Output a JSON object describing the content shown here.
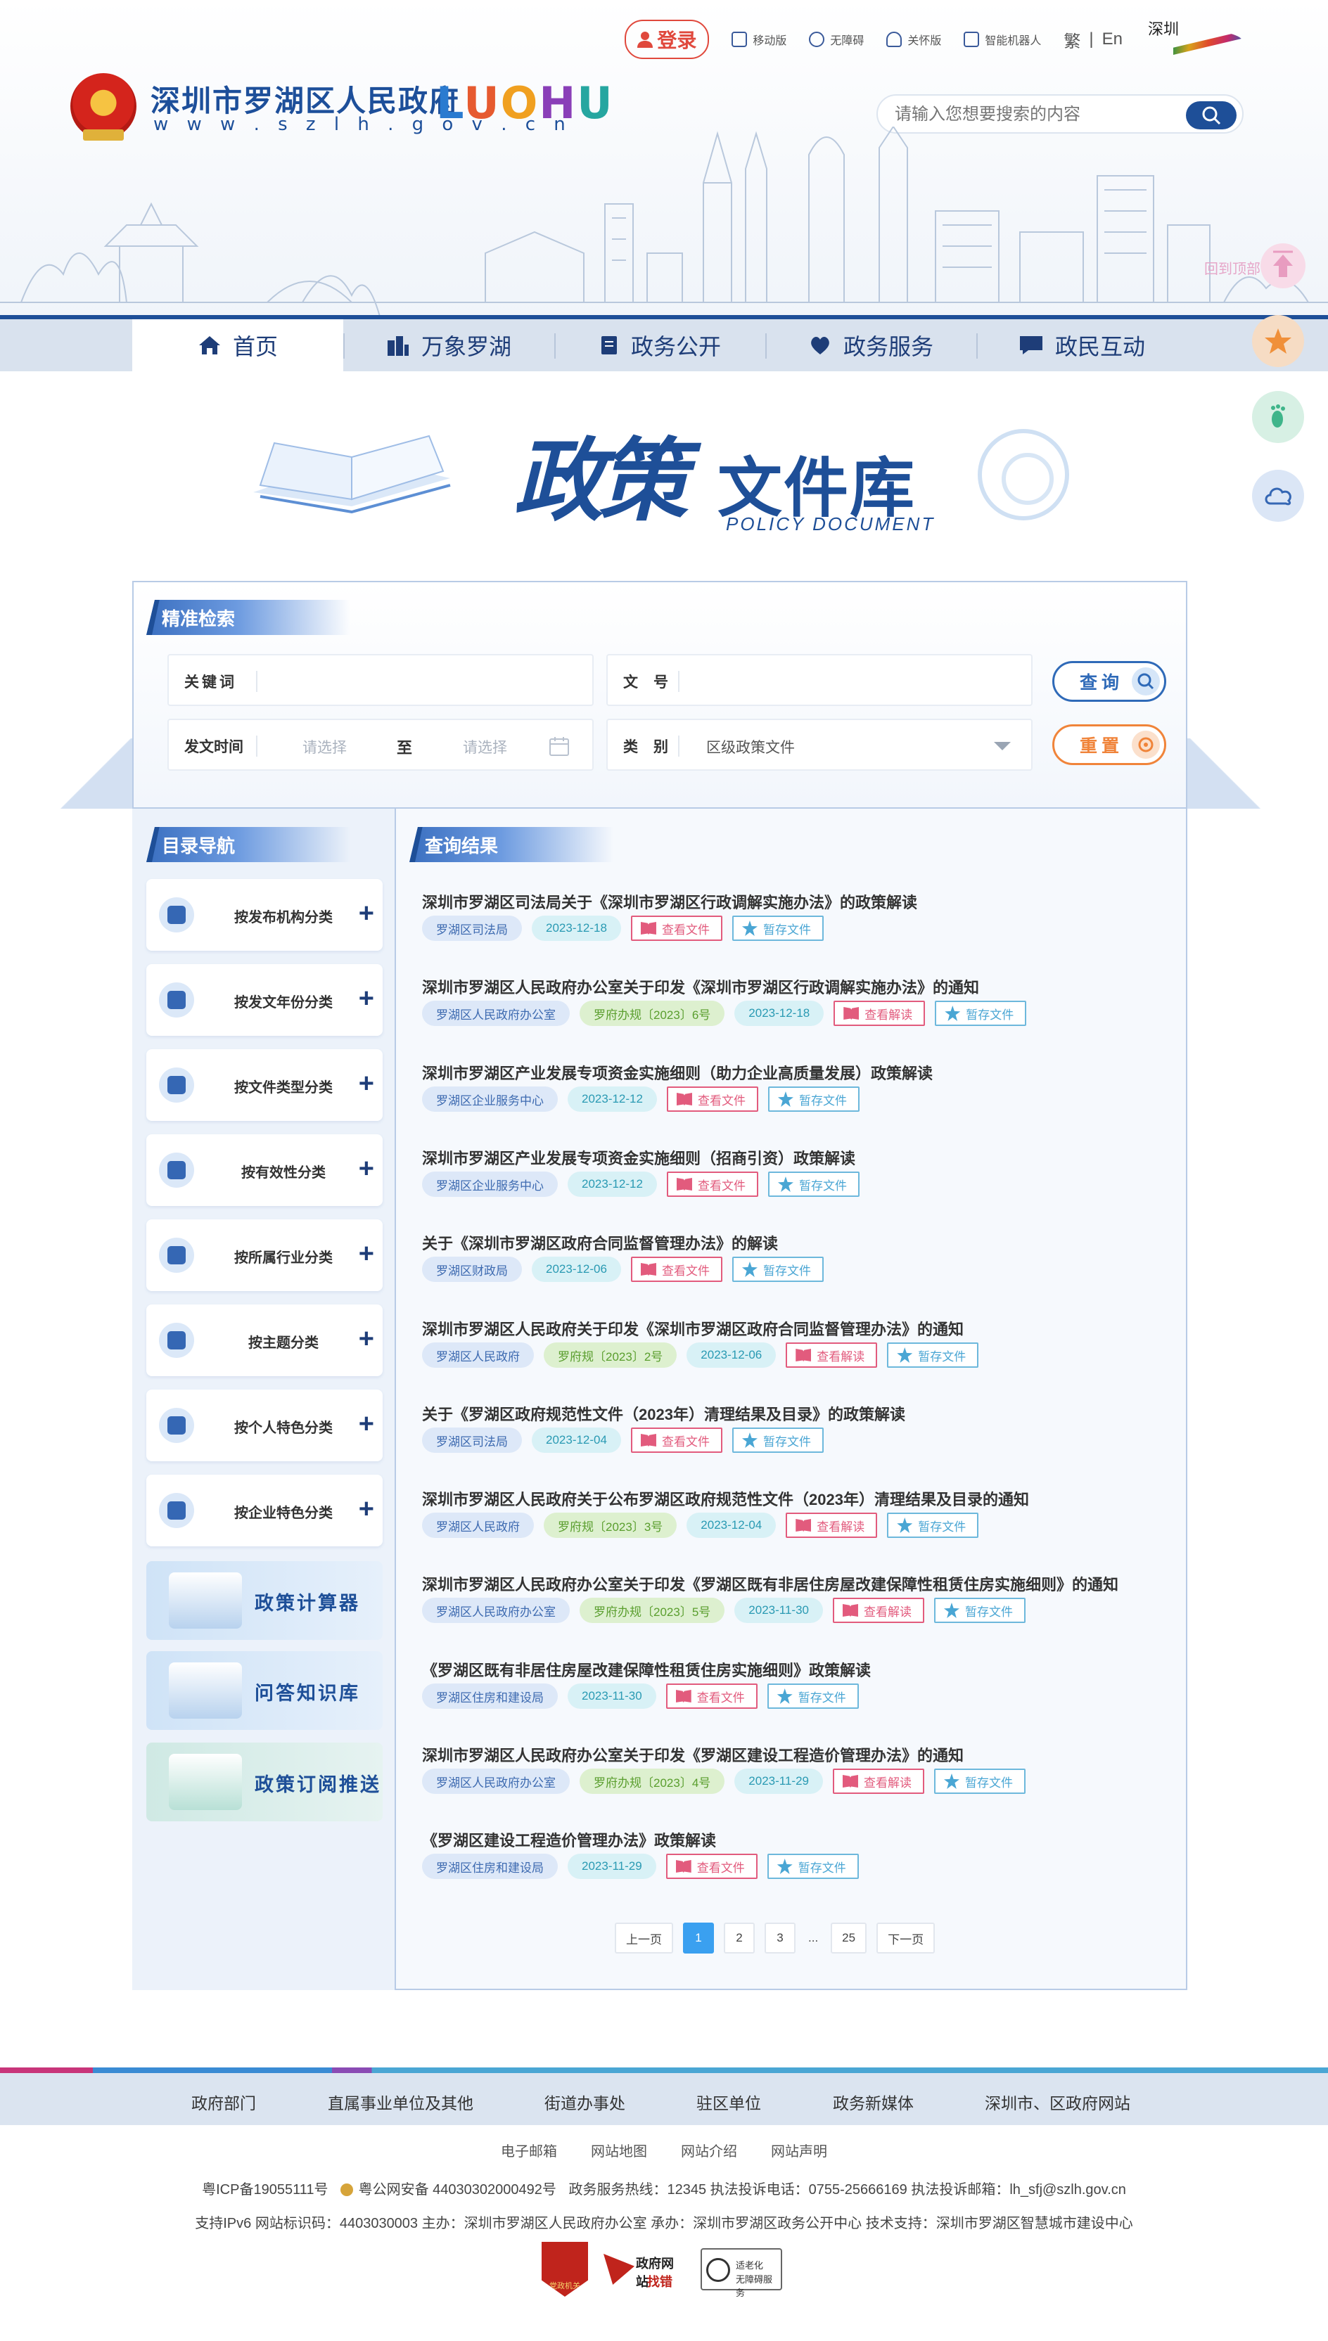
{
  "topbar": {
    "login": "登录",
    "mobile": "移动版",
    "accessible": "无障碍",
    "care": "关怀版",
    "robot": "智能机器人",
    "traditional": "繁",
    "separator": "|",
    "english": "En",
    "shenzhen_logo_text": "深圳"
  },
  "site": {
    "title": "深圳市罗湖区人民政府",
    "url": "w w w . s z l h . g o v . c n",
    "brand": [
      "L",
      "U",
      "O",
      "H",
      "U"
    ]
  },
  "search": {
    "placeholder": "请输入您想要搜索的内容"
  },
  "back_top": "回到顶部",
  "nav": {
    "items": [
      {
        "label": "首页",
        "icon": "home-icon"
      },
      {
        "label": "万象罗湖",
        "icon": "buildings-icon"
      },
      {
        "label": "政务公开",
        "icon": "document-icon"
      },
      {
        "label": "政务服务",
        "icon": "service-icon"
      },
      {
        "label": "政民互动",
        "icon": "chat-icon"
      }
    ]
  },
  "banner": {
    "title_a": "政策",
    "title_b": "文件库",
    "subtitle": "POLICY DOCUMENT"
  },
  "filters": {
    "section_title": "精准检索",
    "keyword_label": "关键词",
    "docno_label": "文号",
    "date_label": "发文时间",
    "date_start_placeholder": "请选择",
    "date_to": "至",
    "date_end_placeholder": "请选择",
    "type_label": "类别",
    "type_value": "区级政策文件",
    "search_btn": "查询",
    "reset_btn": "重置"
  },
  "sidebar": {
    "title": "目录导航",
    "categories": [
      "按发布机构分类",
      "按发文年份分类",
      "按文件类型分类",
      "按有效性分类",
      "按所属行业分类",
      "按主题分类",
      "按个人特色分类",
      "按企业特色分类"
    ],
    "tools": [
      "政策计算器",
      "问答知识库",
      "政策订阅推送"
    ]
  },
  "results": {
    "title": "查询结果",
    "view_doc": "查看文件",
    "view_interp": "查看解读",
    "save_doc": "暂存文件",
    "items": [
      {
        "title": "深圳市罗湖区司法局关于《深圳市罗湖区行政调解实施办法》的政策解读",
        "org": "罗湖区司法局",
        "docno": null,
        "date": "2023-12-18",
        "action": "查看文件"
      },
      {
        "title": "深圳市罗湖区人民政府办公室关于印发《深圳市罗湖区行政调解实施办法》的通知",
        "org": "罗湖区人民政府办公室",
        "docno": "罗府办规〔2023〕6号",
        "date": "2023-12-18",
        "action": "查看解读"
      },
      {
        "title": "深圳市罗湖区产业发展专项资金实施细则（助力企业高质量发展）政策解读",
        "org": "罗湖区企业服务中心",
        "docno": null,
        "date": "2023-12-12",
        "action": "查看文件"
      },
      {
        "title": "深圳市罗湖区产业发展专项资金实施细则（招商引资）政策解读",
        "org": "罗湖区企业服务中心",
        "docno": null,
        "date": "2023-12-12",
        "action": "查看文件"
      },
      {
        "title": "关于《深圳市罗湖区政府合同监督管理办法》的解读",
        "org": "罗湖区财政局",
        "docno": null,
        "date": "2023-12-06",
        "action": "查看文件"
      },
      {
        "title": "深圳市罗湖区人民政府关于印发《深圳市罗湖区政府合同监督管理办法》的通知",
        "org": "罗湖区人民政府",
        "docno": "罗府规〔2023〕2号",
        "date": "2023-12-06",
        "action": "查看解读"
      },
      {
        "title": "关于《罗湖区政府规范性文件（2023年）清理结果及目录》的政策解读",
        "org": "罗湖区司法局",
        "docno": null,
        "date": "2023-12-04",
        "action": "查看文件"
      },
      {
        "title": "深圳市罗湖区人民政府关于公布罗湖区政府规范性文件（2023年）清理结果及目录的通知",
        "org": "罗湖区人民政府",
        "docno": "罗府规〔2023〕3号",
        "date": "2023-12-04",
        "action": "查看解读"
      },
      {
        "title": "深圳市罗湖区人民政府办公室关于印发《罗湖区既有非居住房屋改建保障性租赁住房实施细则》的通知",
        "org": "罗湖区人民政府办公室",
        "docno": "罗府办规〔2023〕5号",
        "date": "2023-11-30",
        "action": "查看解读"
      },
      {
        "title": "《罗湖区既有非居住房屋改建保障性租赁住房实施细则》政策解读",
        "org": "罗湖区住房和建设局",
        "docno": null,
        "date": "2023-11-30",
        "action": "查看文件"
      },
      {
        "title": "深圳市罗湖区人民政府办公室关于印发《罗湖区建设工程造价管理办法》的通知",
        "org": "罗湖区人民政府办公室",
        "docno": "罗府办规〔2023〕4号",
        "date": "2023-11-29",
        "action": "查看解读"
      },
      {
        "title": "《罗湖区建设工程造价管理办法》政策解读",
        "org": "罗湖区住房和建设局",
        "docno": null,
        "date": "2023-11-29",
        "action": "查看文件"
      }
    ]
  },
  "pagination": {
    "prev": "上一页",
    "pages": [
      "1",
      "2",
      "3"
    ],
    "ellipsis": "...",
    "last": "25",
    "next": "下一页",
    "current": "1"
  },
  "footer": {
    "nav": [
      "政府部门",
      "直属事业单位及其他",
      "街道办事处",
      "驻区单位",
      "政务新媒体",
      "深圳市、区政府网站"
    ],
    "links": [
      "电子邮箱",
      "网站地图",
      "网站介绍",
      "网站声明"
    ],
    "line1_icp": "粤ICP备19055111号",
    "line1_police": "粤公网安备 44030302000492号",
    "line1_rest": "政务服务热线：12345    执法投诉电话：0755-25666169    执法投诉邮箱：lh_sfj@szlh.gov.cn",
    "line2": "支持IPv6    网站标识码：4403030003    主办：深圳市罗湖区人民政府办公室    承办：深圳市罗湖区政务公开中心    技术支持：深圳市罗湖区智慧城市建设中心",
    "badge_red": "党政机关",
    "badge_gov_a": "政府网站",
    "badge_gov_b": "找错",
    "badge_acc_a": "适老化",
    "badge_acc_b": "无障碍服务"
  },
  "colors": {
    "primary": "#1e4f98",
    "accent_red": "#e0483c",
    "view_pink": "#e25b7d",
    "save_blue": "#4aa6d4",
    "page_active": "#3aa0f0"
  }
}
